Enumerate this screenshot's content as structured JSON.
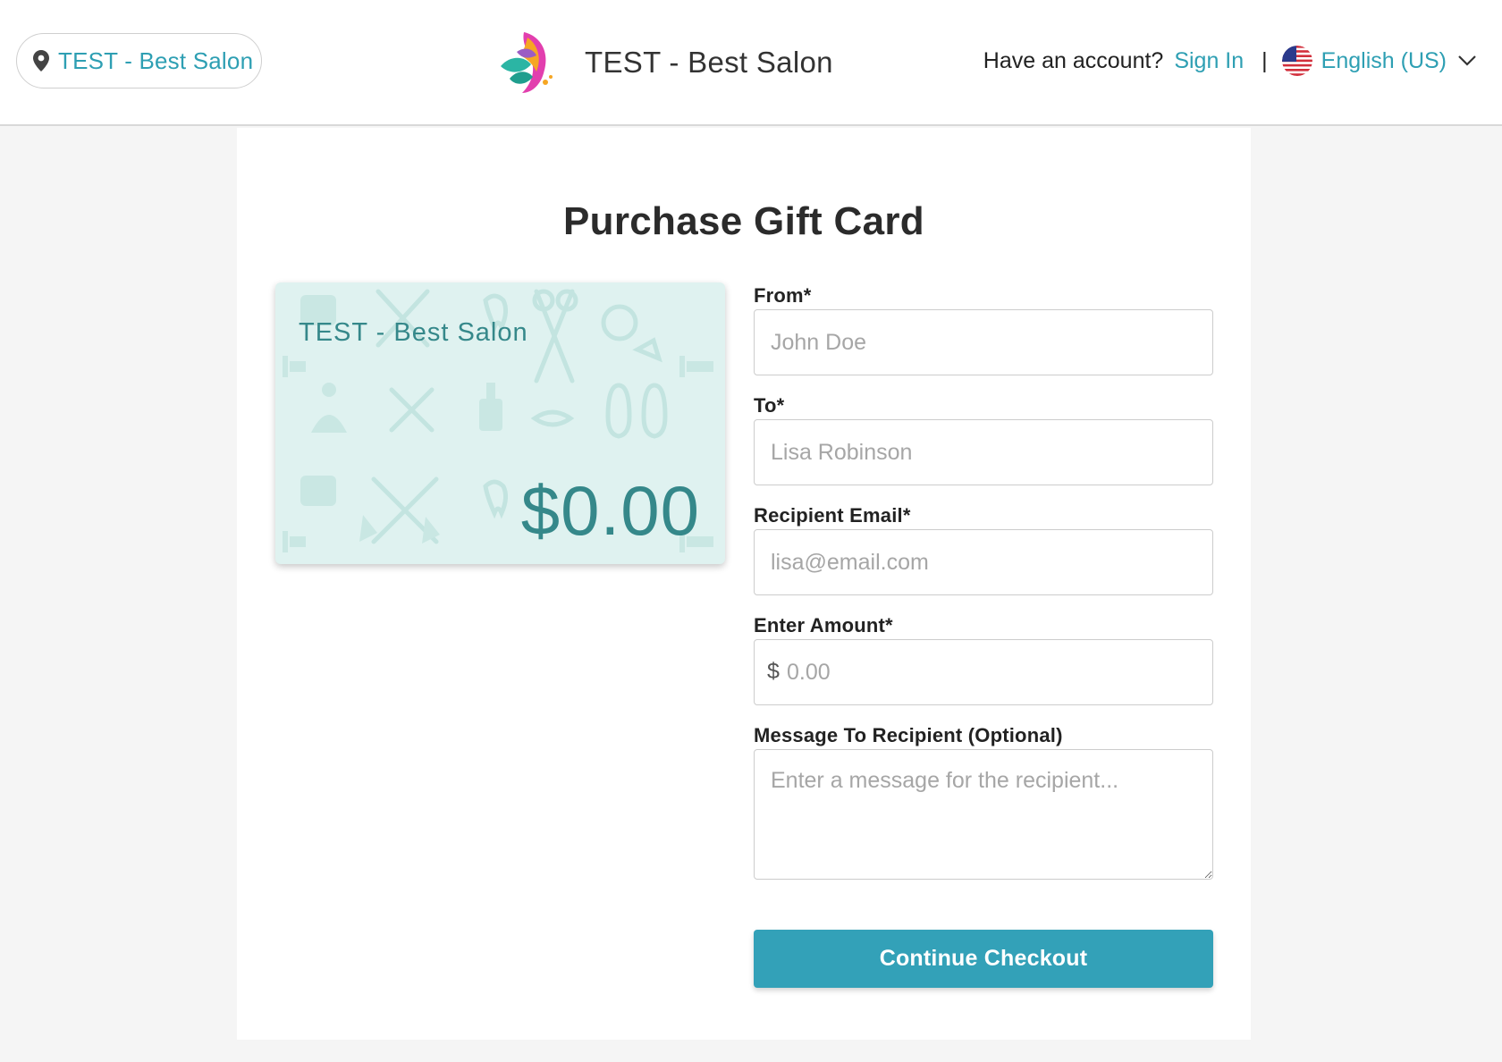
{
  "header": {
    "location_label": "TEST - Best Salon",
    "brand_name": "TEST - Best Salon",
    "account_prompt": "Have an account?",
    "sign_in_label": "Sign In",
    "separator": "|",
    "language_label": "English (US)"
  },
  "page": {
    "title": "Purchase Gift Card"
  },
  "gift_card": {
    "business_name": "TEST - Best Salon",
    "amount": "$0.00"
  },
  "form": {
    "from": {
      "label": "From*",
      "placeholder": "John Doe",
      "value": ""
    },
    "to": {
      "label": "To*",
      "placeholder": "Lisa Robinson",
      "value": ""
    },
    "recipient_email": {
      "label": "Recipient Email*",
      "placeholder": "lisa@email.com",
      "value": ""
    },
    "amount": {
      "label": "Enter Amount*",
      "currency_symbol": "$",
      "placeholder": "0.00",
      "value": ""
    },
    "message": {
      "label": "Message To Recipient (Optional)",
      "placeholder": "Enter a message for the recipient...",
      "value": ""
    },
    "submit_label": "Continue Checkout"
  },
  "icons": [
    "map-pin-icon",
    "salon-logo-icon",
    "us-flag-icon",
    "chevron-down-icon"
  ],
  "colors": {
    "accent": "#2e9fb3",
    "button": "#33a1b8",
    "card_background": "#dff2f0",
    "card_text": "#35888a"
  }
}
